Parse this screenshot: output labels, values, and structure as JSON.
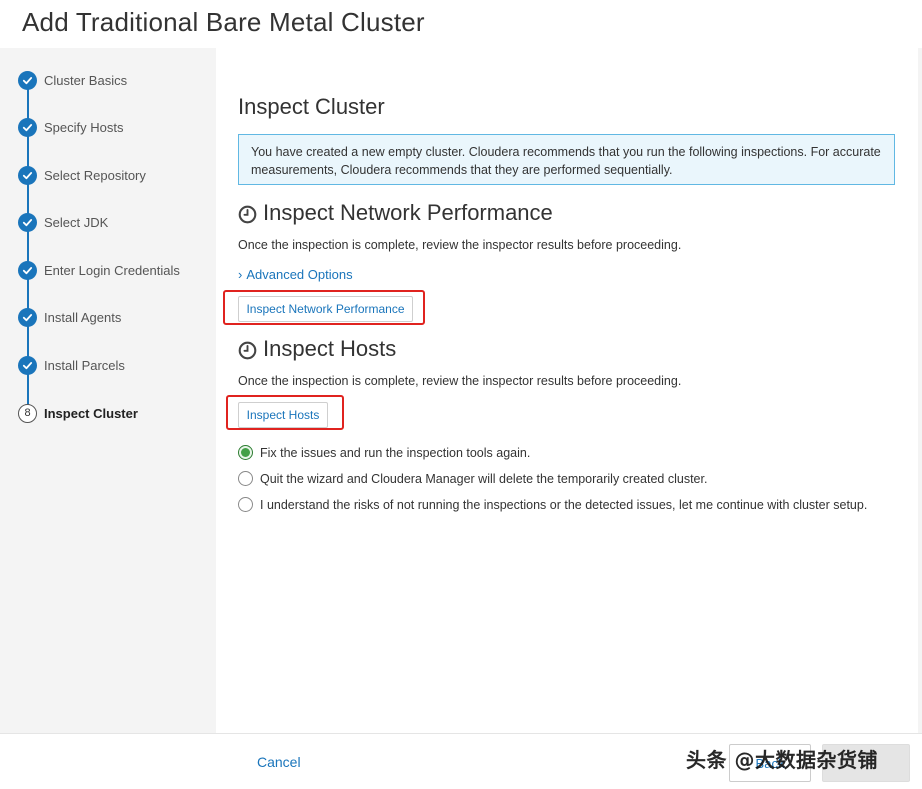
{
  "page": {
    "title": "Add Traditional Bare Metal Cluster"
  },
  "steps": [
    {
      "label": "Cluster Basics",
      "state": "done"
    },
    {
      "label": "Specify Hosts",
      "state": "done"
    },
    {
      "label": "Select Repository",
      "state": "done"
    },
    {
      "label": "Select JDK",
      "state": "done"
    },
    {
      "label": "Enter Login Credentials",
      "state": "done"
    },
    {
      "label": "Install Agents",
      "state": "done"
    },
    {
      "label": "Install Parcels",
      "state": "done"
    },
    {
      "label": "Inspect Cluster",
      "state": "active",
      "number": "8"
    }
  ],
  "main": {
    "title": "Inspect Cluster",
    "info": "You have created a new empty cluster. Cloudera recommends that you run the following inspections. For accurate measurements, Cloudera recommends that they are performed sequentially.",
    "network": {
      "heading": "Inspect Network Performance",
      "desc": "Once the inspection is complete, review the inspector results before proceeding.",
      "advanced_label": "Advanced Options",
      "button_label": "Inspect Network Performance"
    },
    "hosts": {
      "heading": "Inspect Hosts",
      "desc": "Once the inspection is complete, review the inspector results before proceeding.",
      "button_label": "Inspect Hosts"
    },
    "options": [
      {
        "label": "Fix the issues and run the inspection tools again.",
        "checked": true
      },
      {
        "label": "Quit the wizard and Cloudera Manager will delete the temporarily created cluster.",
        "checked": false
      },
      {
        "label": "I understand the risks of not running the inspections or the detected issues, let me continue with cluster setup.",
        "checked": false
      }
    ]
  },
  "footer": {
    "cancel_label": "Cancel",
    "back_label": "Back",
    "watermark": "头条 @大数据杂货铺"
  },
  "colors": {
    "accent": "#1a75bb",
    "highlight": "#e0231f",
    "info_bg": "#eaf6fc",
    "radio_checked": "#43a047"
  }
}
